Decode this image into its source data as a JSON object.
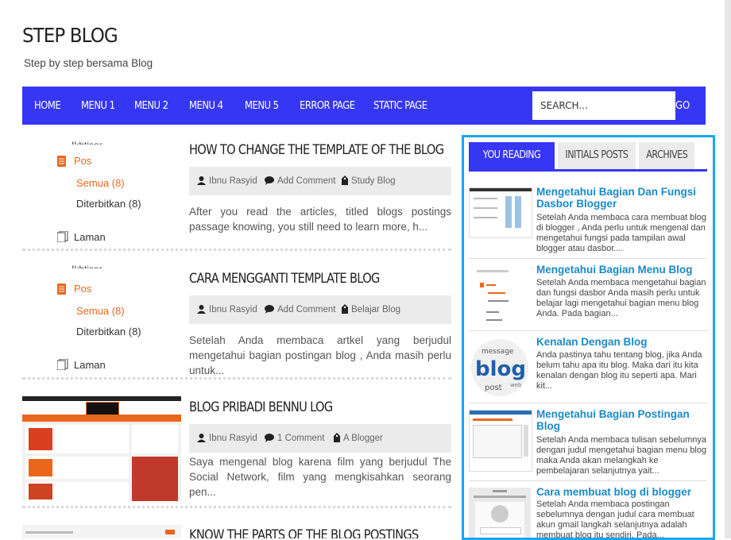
{
  "header": {
    "title": "STEP BLOG",
    "description": "Step by step bersama Blog"
  },
  "nav": {
    "items": [
      "HOME",
      "MENU 1",
      "MENU 2",
      "MENU 4",
      "MENU 5",
      "ERROR PAGE",
      "STATIC PAGE"
    ],
    "search_placeholder": "SEARCH...",
    "go_label": "GO"
  },
  "posts": [
    {
      "title": "HOW TO CHANGE THE TEMPLATE OF THE BLOG",
      "author": "Ibnu Rasyid",
      "comments": "Add Comment",
      "label": "Study Blog",
      "snippet": "After you read the articles, titled blogs postings passage knowing, you still need to learn more, h...",
      "thumb": {
        "cut": "Ikhtisar",
        "pos": "Pos",
        "semua": "Semua (8)",
        "diterbitkan": "Diterbitkan (8)",
        "laman": "Laman"
      }
    },
    {
      "title": "CARA MENGGANTI TEMPLATE BLOG",
      "author": "Ibnu Rasyid",
      "comments": "Add Comment",
      "label": "Belajar Blog",
      "snippet": "Setelah Anda membaca artkel yang berjudul mengetahui bagian postingan blog , Anda masih perlu untuk...",
      "thumb": {
        "cut": "Ikhtisar",
        "pos": "Pos",
        "semua": "Semua (8)",
        "diterbitkan": "Diterbitkan (8)",
        "laman": "Laman"
      }
    },
    {
      "title": "BLOG PRIBADI BENNU LOG",
      "author": "Ibnu Rasyid",
      "comments": "1 Comment",
      "label": "A Blogger",
      "snippet": "Saya mengenal blog karena film yang berjudul The Social Network, film yang mengkisahkan seorang pen..."
    },
    {
      "title": "KNOW THE PARTS OF THE BLOG POSTINGS"
    }
  ],
  "sidebar": {
    "tabs": [
      "YOU READING THIS",
      "INITIALS POSTS",
      "ARCHIVES"
    ],
    "items": [
      {
        "title": "Mengetahui Bagian Dan Fungsi Dasbor Blogger",
        "text": "Setelah Anda membaca cara membuat blog di blogger , Anda perlu untuk mengenal dan mengetahui fungsi pada tampilan awal blogger atau dasbor...."
      },
      {
        "title": "Mengetahui Bagian Menu Blog",
        "text": "Setelah Anda membaca mengetahui bagian dan fungsi dasbor  Anda masih perlu untuk belajar lagi mengetahui bagian menu blog Anda. Pada bagian..."
      },
      {
        "title": "Kenalan Dengan Blog",
        "text": "Anda pastinya tahu tentang blog, jika Anda belum tahu apa itu blog. Maka dari itu kita kenalan dengan blog itu seperti apa.  Mari kit..."
      },
      {
        "title": "Mengetahui Bagian Postingan Blog",
        "text": "Setelah Anda membaca tulisan sebelumnya dengan judul mengetahui bagian menu blog  maka Anda akan melangkah ke pembelajaran selanjutnya yait..."
      },
      {
        "title": "Cara membuat blog di blogger",
        "text": "Setelah Anda membaca postingan sebelumnya dengan judul cara membuat akun gmail  langkah selanjutnya adalah membuat blog itu sendiri. Pada..."
      }
    ]
  },
  "colors": {
    "nav": "#3636f5",
    "accent_border": "#1aa7ec",
    "link": "#1a8ac7",
    "orange": "#e8671c"
  }
}
